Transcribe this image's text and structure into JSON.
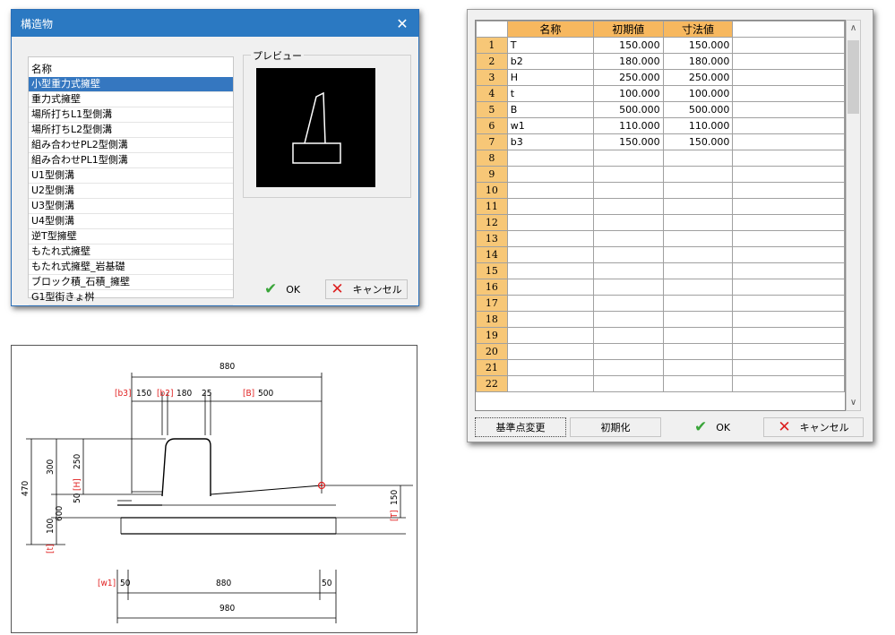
{
  "structure_dialog": {
    "title": "構造物",
    "list_header": "名称",
    "items": [
      "小型重力式擁壁",
      "重力式擁壁",
      "場所打ちL1型側溝",
      "場所打ちL2型側溝",
      "組み合わせPL2型側溝",
      "組み合わせPL1型側溝",
      "U1型側溝",
      "U2型側溝",
      "U3型側溝",
      "U4型側溝",
      "逆T型擁壁",
      "もたれ式擁壁",
      "もたれ式擁壁_岩基礎",
      "ブロック積_石積_擁壁",
      "G1型街きょ桝"
    ],
    "selected_index": 0,
    "preview_label": "プレビュー",
    "ok_label": "OK",
    "cancel_label": "キャンセル"
  },
  "param_grid": {
    "headers": [
      "名称",
      "初期値",
      "寸法値"
    ],
    "rows": [
      {
        "no": "1",
        "name": "T",
        "initial": "150.000",
        "value": "150.000"
      },
      {
        "no": "2",
        "name": "b2",
        "initial": "180.000",
        "value": "180.000"
      },
      {
        "no": "3",
        "name": "H",
        "initial": "250.000",
        "value": "250.000"
      },
      {
        "no": "4",
        "name": "t",
        "initial": "100.000",
        "value": "100.000"
      },
      {
        "no": "5",
        "name": "B",
        "initial": "500.000",
        "value": "500.000"
      },
      {
        "no": "6",
        "name": "w1",
        "initial": "110.000",
        "value": "110.000"
      },
      {
        "no": "7",
        "name": "b3",
        "initial": "150.000",
        "value": "150.000"
      }
    ],
    "empty_row_numbers": [
      "8",
      "9",
      "10",
      "11",
      "12",
      "13",
      "14",
      "15",
      "16",
      "17",
      "18",
      "19",
      "20",
      "21",
      "22"
    ],
    "btn_reference": "基準点変更",
    "btn_reset": "初期化",
    "ok_label": "OK",
    "cancel_label": "キャンセル"
  },
  "drawing": {
    "top_dim": "880",
    "seg_b3_label": "[b3]",
    "seg_b3_value": "150",
    "seg_b2_label": "[b2]",
    "seg_180": "180",
    "seg_25": "25",
    "seg_B_label": "[B]",
    "seg_B_value": "500",
    "left_470": "470",
    "left_300": "300",
    "left_250": "250",
    "left_H_label": "[H]",
    "left_50": "50",
    "left_600": "600",
    "left_100": "100",
    "left_t_label": "[t]",
    "right_T_label": "[T]",
    "right_150": "150",
    "w1_label": "[w1]",
    "w1_value": "50",
    "bottom_880": "880",
    "bottom_50": "50",
    "bottom_980": "980",
    "accent_red": "#e02020"
  }
}
